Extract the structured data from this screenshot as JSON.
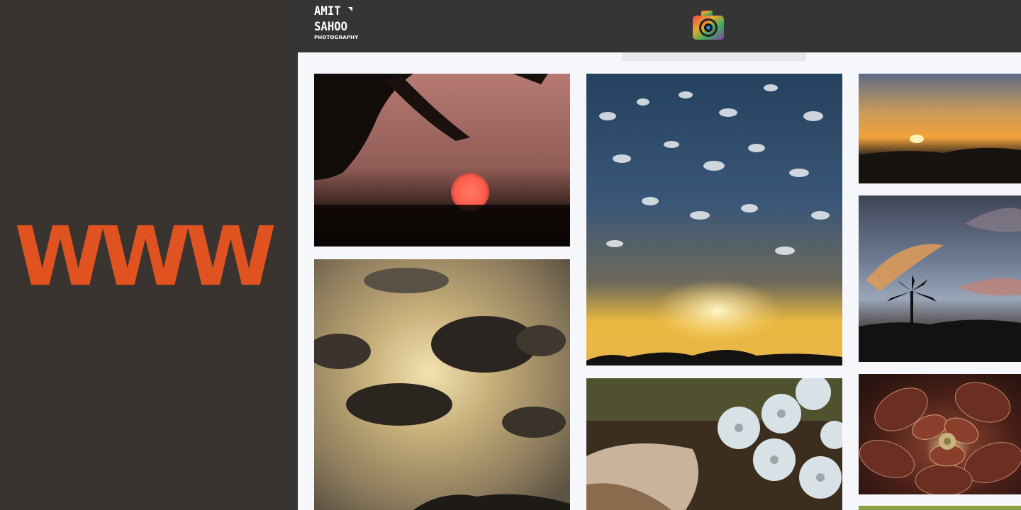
{
  "left_panel": {
    "logo_text": "WWW",
    "logo_color": "#e0521f",
    "background": "#3a3431"
  },
  "header": {
    "brand_line1": "AMIT",
    "brand_line2": "SAHOO",
    "brand_line3": "PHOTOGRAPHY",
    "camera_icon": "camera-icon"
  },
  "gallery": {
    "photos": [
      {
        "name": "photo-blurred-sunset-tree"
      },
      {
        "name": "photo-dramatic-clouds"
      },
      {
        "name": "photo-sunrays-clouds"
      },
      {
        "name": "photo-white-flowers"
      },
      {
        "name": "photo-sunset-horizon"
      },
      {
        "name": "photo-palm-silhouette"
      },
      {
        "name": "photo-succulent-closeup"
      }
    ]
  }
}
